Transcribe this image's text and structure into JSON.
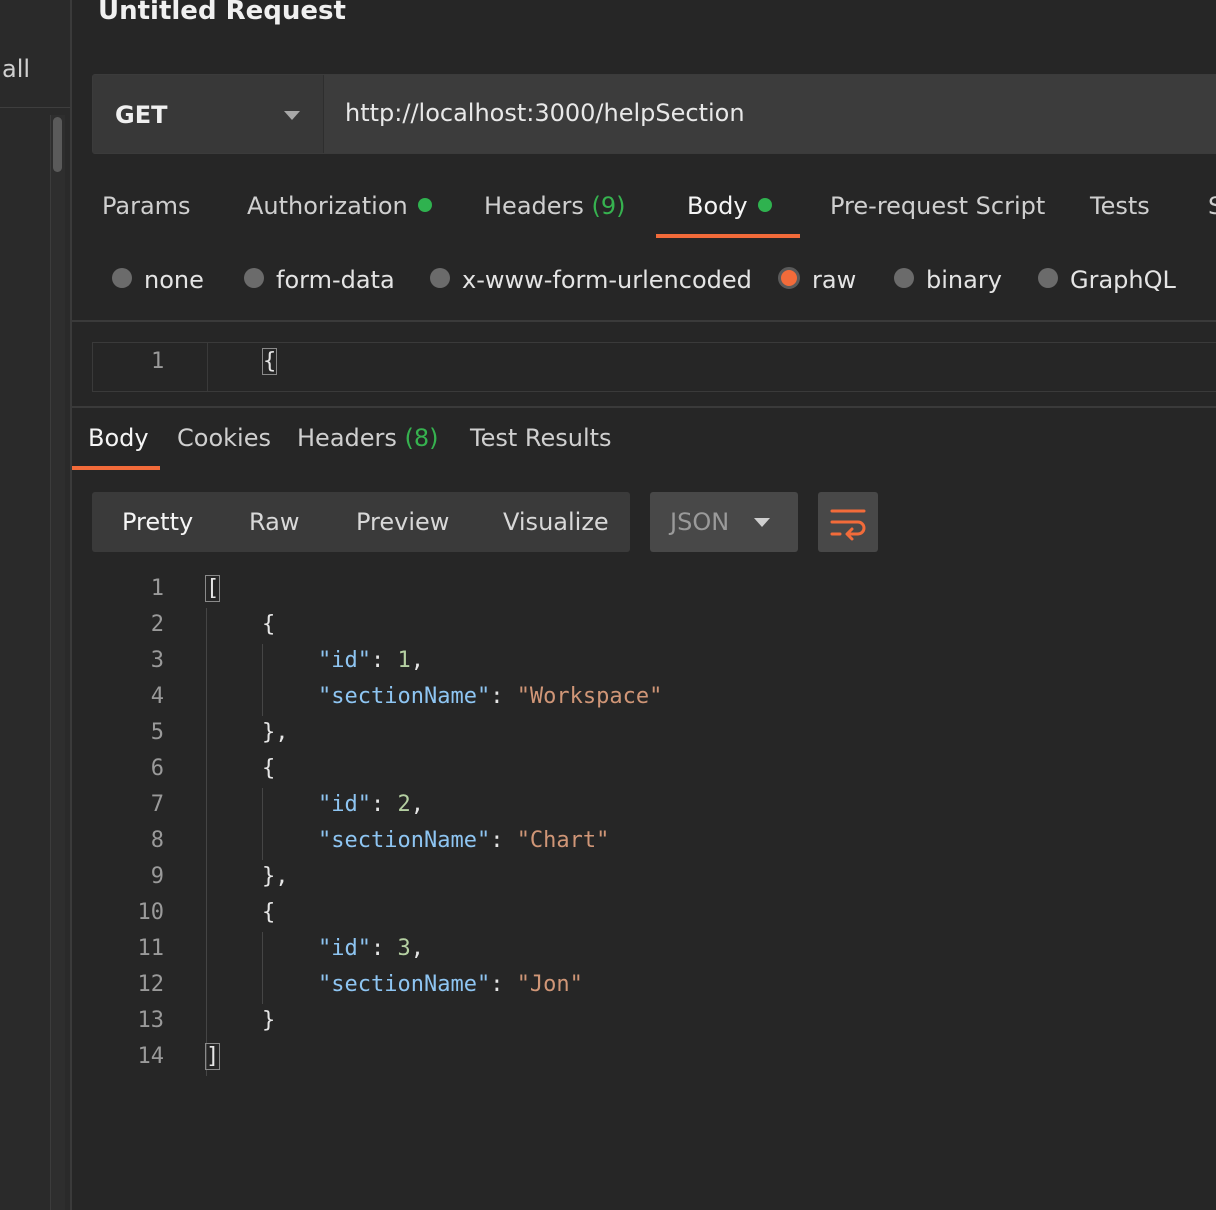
{
  "sidebar": {
    "partial_label": "all"
  },
  "request": {
    "title": "Untitled Request",
    "method": "GET",
    "url": "http://localhost:3000/helpSection"
  },
  "request_tabs": {
    "params": "Params",
    "authorization": "Authorization",
    "headers": "Headers",
    "headers_count": "(9)",
    "body": "Body",
    "prerequest": "Pre-request Script",
    "tests": "Tests",
    "settings_partial": "S"
  },
  "body_types": {
    "none": "none",
    "form_data": "form-data",
    "urlencoded": "x-www-form-urlencoded",
    "raw": "raw",
    "binary": "binary",
    "graphql": "GraphQL"
  },
  "request_body": {
    "line_number": "1",
    "first_line": "{"
  },
  "response_tabs": {
    "body": "Body",
    "cookies": "Cookies",
    "headers": "Headers",
    "headers_count": "(8)",
    "test_results": "Test Results"
  },
  "view_modes": {
    "pretty": "Pretty",
    "raw": "Raw",
    "preview": "Preview",
    "visualize": "Visualize"
  },
  "format": {
    "selected": "JSON"
  },
  "response_body": {
    "lines": [
      {
        "n": "1",
        "t": "["
      },
      {
        "n": "2",
        "t": "{"
      },
      {
        "n": "3",
        "key": "\"id\"",
        "val": "1",
        "vtype": "num",
        "comma": ","
      },
      {
        "n": "4",
        "key": "\"sectionName\"",
        "val": "\"Workspace\"",
        "vtype": "str",
        "comma": ""
      },
      {
        "n": "5",
        "t": "},"
      },
      {
        "n": "6",
        "t": "{"
      },
      {
        "n": "7",
        "key": "\"id\"",
        "val": "2",
        "vtype": "num",
        "comma": ","
      },
      {
        "n": "8",
        "key": "\"sectionName\"",
        "val": "\"Chart\"",
        "vtype": "str",
        "comma": ""
      },
      {
        "n": "9",
        "t": "},"
      },
      {
        "n": "10",
        "t": "{"
      },
      {
        "n": "11",
        "key": "\"id\"",
        "val": "3",
        "vtype": "num",
        "comma": ","
      },
      {
        "n": "12",
        "key": "\"sectionName\"",
        "val": "\"Jon\"",
        "vtype": "str",
        "comma": ""
      },
      {
        "n": "13",
        "t": "}"
      },
      {
        "n": "14",
        "t": "]"
      }
    ]
  },
  "colors": {
    "accent": "#f26b3a",
    "status_dot": "#2fb24f",
    "json_key": "#8ec5f2",
    "json_number": "#b5d0a2",
    "json_string": "#d09677"
  }
}
